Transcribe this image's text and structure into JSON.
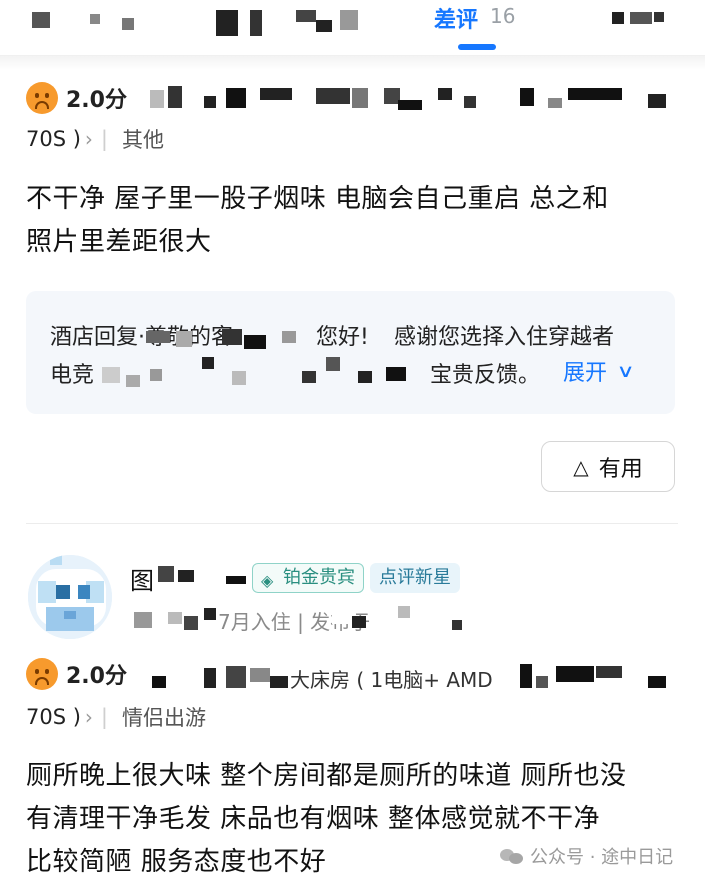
{
  "tabs": {
    "active_label": "差评",
    "active_count": "16"
  },
  "reviews": [
    {
      "score": "2.0分",
      "room_suffix": "70S )",
      "trip_type": "其他",
      "text_line1": "不干净 屋子里一股子烟味 电脑会自己重启 总之和",
      "text_line2": "照片里差距很大",
      "reply": {
        "line1_prefix": "酒店回复·尊敬的客",
        "line1_middle": "您好!",
        "line1_suffix": "感谢您选择入住穿越者",
        "line2_prefix": "电竞",
        "line2_suffix": "宝贵反馈。",
        "expand_label": "展开"
      },
      "useful_label": "有用"
    },
    {
      "username_char": "图",
      "badge_platinum": "铂金贵宾",
      "badge_star": "点评新星",
      "stay_info": "7月入住 | 发布于",
      "score": "2.0分",
      "room_visible": "大床房 ( 1电脑+ AMD",
      "room_suffix": "70S )",
      "trip_type": "情侣出游",
      "text_line1": "厕所晚上很大味 整个房间都是厕所的味道 厕所也没",
      "text_line2": "有清理干净毛发 床品也有烟味 整体感觉就不干净",
      "text_line3": "比较简陋 服务态度也不好"
    }
  ],
  "watermark": "公众号 · 途中日记",
  "colors": {
    "accent": "#1677ff",
    "score_face": "#f79a2d",
    "reply_bg": "#f4f7fb",
    "badge_green": "#2a8f80"
  },
  "icons": [
    "sad-face-icon",
    "chevron-right-icon",
    "chevron-down-icon",
    "thumb-up-triangle-icon",
    "diamond-icon",
    "wechat-icon"
  ]
}
